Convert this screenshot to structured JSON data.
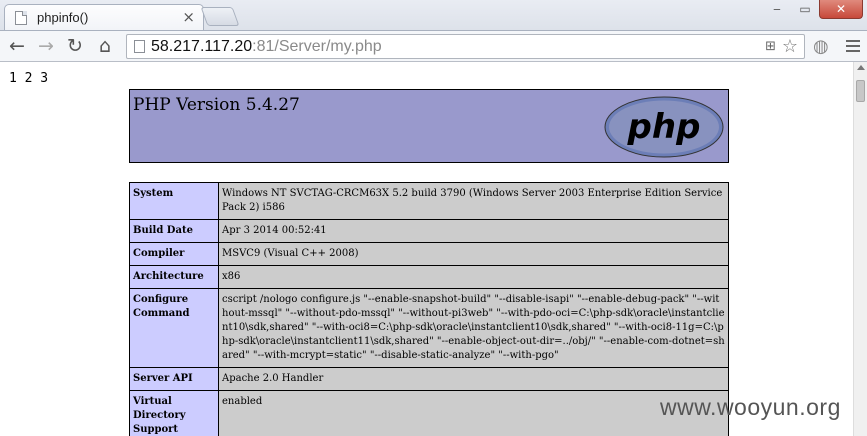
{
  "browser": {
    "tab_title": "phpinfo()",
    "url_host": "58.217.117.20",
    "url_rest": ":81/Server/my.php"
  },
  "page": {
    "prefix_text": "1 2 3",
    "header_title": "PHP Version 5.4.27",
    "logo_text": "php",
    "rows": [
      {
        "label": "System",
        "value": "Windows NT SVCTAG-CRCM63X 5.2 build 3790 (Windows Server 2003 Enterprise Edition Service Pack 2) i586"
      },
      {
        "label": "Build Date",
        "value": "Apr 3 2014 00:52:41"
      },
      {
        "label": "Compiler",
        "value": "MSVC9 (Visual C++ 2008)"
      },
      {
        "label": "Architecture",
        "value": "x86"
      },
      {
        "label": "Configure Command",
        "value": "cscript /nologo configure.js \"--enable-snapshot-build\" \"--disable-isapi\" \"--enable-debug-pack\" \"--without-mssql\" \"--without-pdo-mssql\" \"--without-pi3web\" \"--with-pdo-oci=C:\\php-sdk\\oracle\\instantclient10\\sdk,shared\" \"--with-oci8=C:\\php-sdk\\oracle\\instantclient10\\sdk,shared\" \"--with-oci8-11g=C:\\php-sdk\\oracle\\instantclient11\\sdk,shared\" \"--enable-object-out-dir=../obj/\" \"--enable-com-dotnet=shared\" \"--with-mcrypt=static\" \"--disable-static-analyze\" \"--with-pgo\""
      },
      {
        "label": "Server API",
        "value": "Apache 2.0 Handler"
      },
      {
        "label": "Virtual Directory Support",
        "value": "enabled"
      }
    ]
  },
  "watermark": "www.wooyun.org",
  "colors": {
    "header_bg": "#9999cc",
    "label_bg": "#ccccff",
    "value_bg": "#cccccc"
  }
}
